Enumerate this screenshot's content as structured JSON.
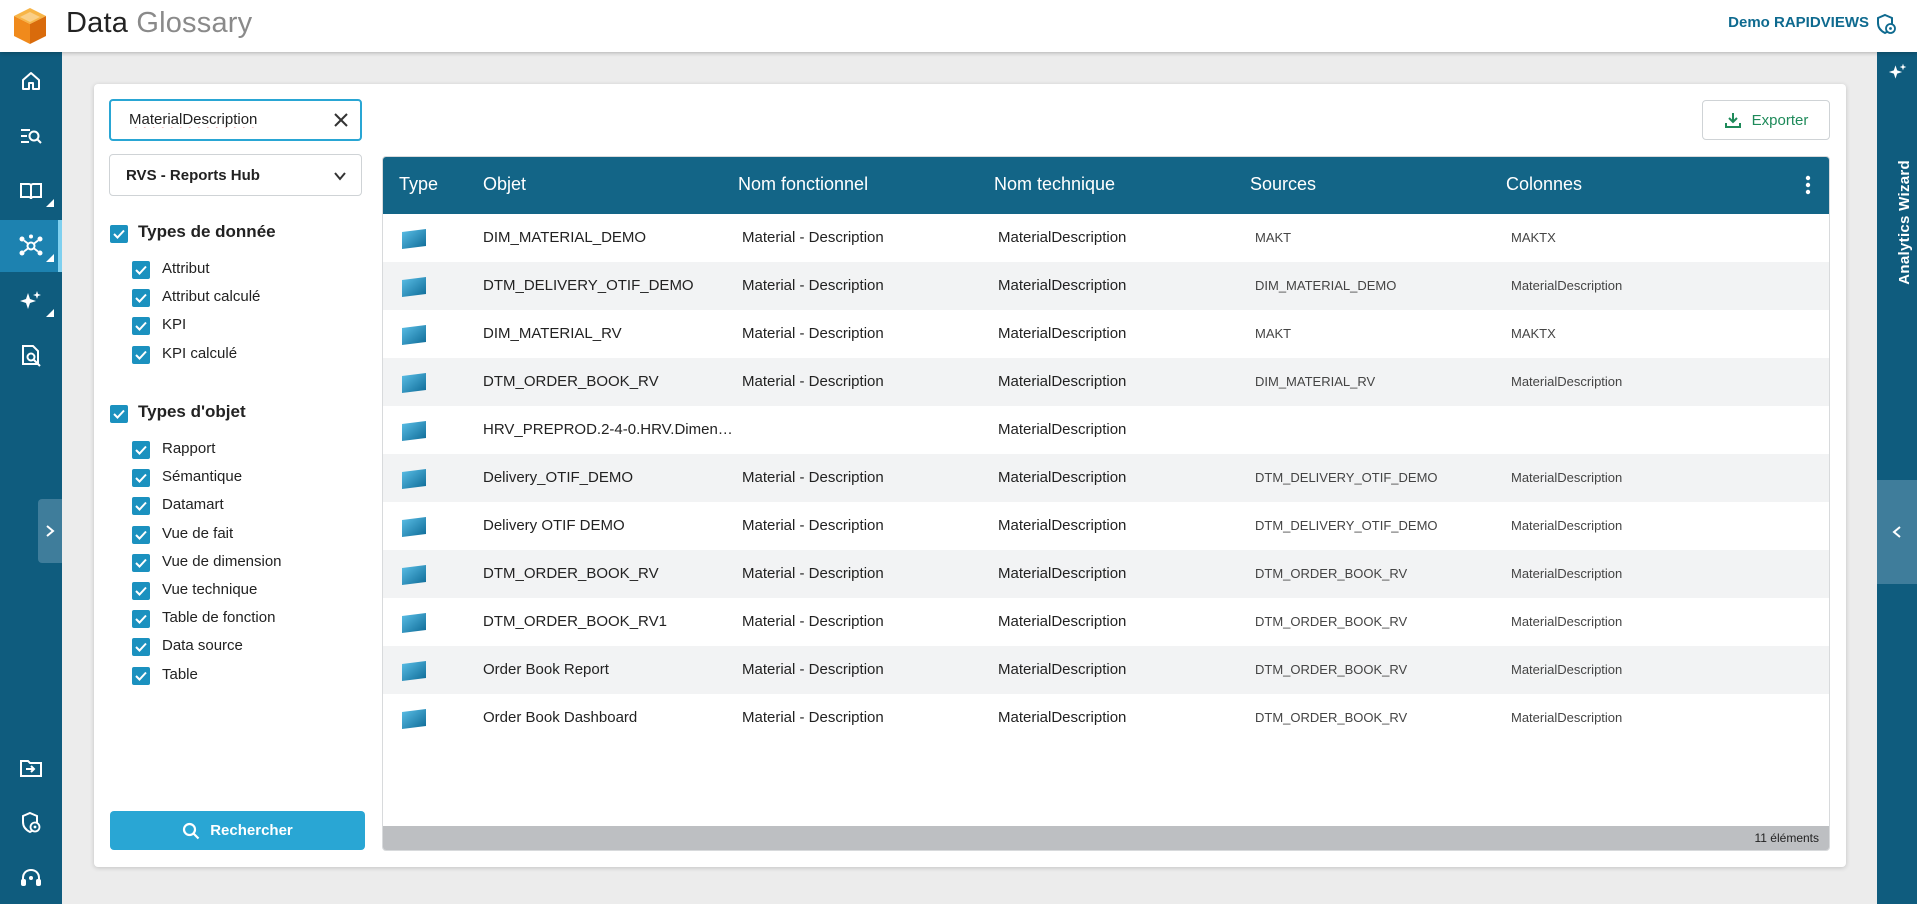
{
  "header": {
    "title_main": "Data",
    "title_light": " Glossary",
    "user": "Demo RAPIDVIEWS"
  },
  "sidebar": {
    "items": [
      {
        "icon": "home-icon"
      },
      {
        "icon": "search-list-icon"
      },
      {
        "icon": "book-icon"
      },
      {
        "icon": "network-icon",
        "active": true
      },
      {
        "icon": "sparkles-icon"
      },
      {
        "icon": "document-search-icon"
      },
      {
        "icon": "folder-import-icon"
      },
      {
        "icon": "shield-gear-icon"
      },
      {
        "icon": "support-headset-icon"
      }
    ]
  },
  "right_panel": {
    "label": "Analytics Wizard"
  },
  "search": {
    "value": "MaterialDescription"
  },
  "select": {
    "value": "RVS - Reports Hub"
  },
  "filters": {
    "data_types": {
      "title": "Types de donnée",
      "items": [
        "Attribut",
        "Attribut calculé",
        "KPI",
        "KPI calculé"
      ]
    },
    "object_types": {
      "title": "Types d'objet",
      "items": [
        "Rapport",
        "Sémantique",
        "Datamart",
        "Vue de fait",
        "Vue de dimension",
        "Vue technique",
        "Table de fonction",
        "Data source",
        "Table"
      ]
    }
  },
  "actions": {
    "search": "Rechercher",
    "export": "Exporter"
  },
  "table": {
    "columns": [
      "Type",
      "Objet",
      "Nom fonctionnel",
      "Nom technique",
      "Sources",
      "Colonnes"
    ],
    "rows": [
      {
        "objet": "DIM_MATERIAL_DEMO",
        "fonctionnel": "Material - Description",
        "technique": "MaterialDescription",
        "sources": "MAKT",
        "colonnes": "MAKTX"
      },
      {
        "objet": "DTM_DELIVERY_OTIF_DEMO",
        "fonctionnel": "Material - Description",
        "technique": "MaterialDescription",
        "sources": "DIM_MATERIAL_DEMO",
        "colonnes": "MaterialDescription"
      },
      {
        "objet": "DIM_MATERIAL_RV",
        "fonctionnel": "Material - Description",
        "technique": "MaterialDescription",
        "sources": "MAKT",
        "colonnes": "MAKTX"
      },
      {
        "objet": "DTM_ORDER_BOOK_RV",
        "fonctionnel": "Material - Description",
        "technique": "MaterialDescription",
        "sources": "DIM_MATERIAL_RV",
        "colonnes": "MaterialDescription"
      },
      {
        "objet": "HRV_PREPROD.2-4-0.HRV.Dimen…",
        "fonctionnel": "",
        "technique": "MaterialDescription",
        "sources": "",
        "colonnes": ""
      },
      {
        "objet": "Delivery_OTIF_DEMO",
        "fonctionnel": "Material - Description",
        "technique": "MaterialDescription",
        "sources": "DTM_DELIVERY_OTIF_DEMO",
        "colonnes": "MaterialDescription"
      },
      {
        "objet": "Delivery OTIF DEMO",
        "fonctionnel": "Material - Description",
        "technique": "MaterialDescription",
        "sources": "DTM_DELIVERY_OTIF_DEMO",
        "colonnes": "MaterialDescription"
      },
      {
        "objet": "DTM_ORDER_BOOK_RV",
        "fonctionnel": "Material - Description",
        "technique": "MaterialDescription",
        "sources": "DTM_ORDER_BOOK_RV",
        "colonnes": "MaterialDescription"
      },
      {
        "objet": "DTM_ORDER_BOOK_RV1",
        "fonctionnel": "Material - Description",
        "technique": "MaterialDescription",
        "sources": "DTM_ORDER_BOOK_RV",
        "colonnes": "MaterialDescription"
      },
      {
        "objet": "Order Book Report",
        "fonctionnel": "Material - Description",
        "technique": "MaterialDescription",
        "sources": "DTM_ORDER_BOOK_RV",
        "colonnes": "MaterialDescription"
      },
      {
        "objet": "Order Book Dashboard",
        "fonctionnel": "Material - Description",
        "technique": "MaterialDescription",
        "sources": "DTM_ORDER_BOOK_RV",
        "colonnes": "MaterialDescription"
      }
    ],
    "footer": "11 éléments"
  },
  "colors": {
    "nav": "#0f5c7e",
    "accent": "#29a6d4",
    "table_header": "#136587",
    "export": "#1e8a5a"
  }
}
